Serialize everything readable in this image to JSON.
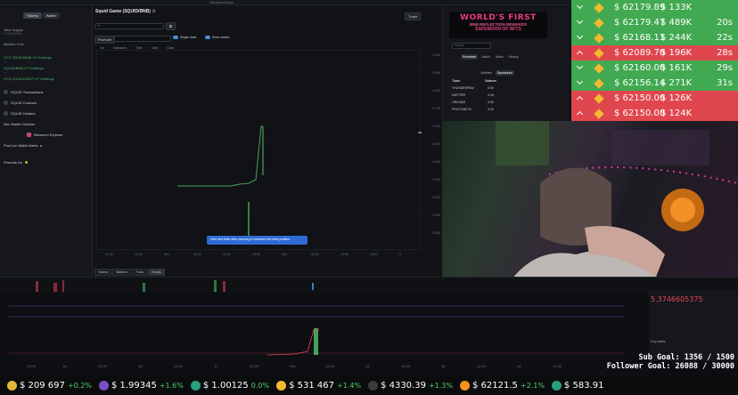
{
  "top_strip": {
    "title": "Advanced Now"
  },
  "sidebar": {
    "toggle": [
      "Tokens",
      "Wallet"
    ],
    "total_supply_label": "Total Supply",
    "total_supply_value": "0.000000000",
    "marked_coin_label": "Marked Coin",
    "lines": [
      "PCS SQUID/BNB LP Holdings",
      "SQUID/BNB LP Holdings",
      "PCS SQUID/USDT LP Holdings"
    ],
    "items": [
      "SQUID Transactions",
      "SQUID Contract",
      "SQUID Holders",
      "Dev Wallet Checker",
      "Bitsearch Explorer",
      "PooCoin Wallet Alerts"
    ],
    "promote_label": "Promote Ad"
  },
  "main": {
    "title": "Squid Game (SQUID/BNB)",
    "promote": "Promote",
    "trade": "Trade",
    "address_placeholder": "0x...",
    "toolbar": [
      "1m",
      "Indicators",
      "Time",
      "Limit",
      "Clear"
    ],
    "single_chart": "Single chart",
    "show_trades": "Show trades",
    "y_ticks": [
      "1.000",
      "0.900",
      "0.800",
      "0.700",
      "0.600",
      "0.500",
      "0.400",
      "0.300",
      "0.200",
      "0.100",
      "0.000"
    ],
    "x_ticks": [
      "12:00",
      "18:00",
      "Nov",
      "06:00",
      "12:00",
      "18:00",
      "Nov",
      "06:00",
      "12:00",
      "18:00",
      "2"
    ],
    "tooltip": "Hold and flash  after pausing to maintain the chart position",
    "bottom_tabs": [
      "Tokens",
      "Wallet tx",
      "Pools",
      "Swaps"
    ]
  },
  "right_panel": {
    "banner_l1": "WORLD'S FIRST",
    "banner_l2": "BNB REFLECTION REWARDS",
    "banner_l3": "SAFEMOON OF NFTS",
    "search_placeholder": "Search",
    "tabs": [
      "Promoted",
      "Watch",
      "Alerts",
      "History"
    ],
    "subtabs": [
      "Unlisted",
      "Sponsored"
    ],
    "columns": [
      "Token",
      "Balance"
    ],
    "rows": [
      {
        "token": "THUNDERPAW",
        "balance": "0.00"
      },
      {
        "token": "DWTTER",
        "balance": "0.00"
      },
      {
        "token": "ORIGAMI",
        "balance": "0.00"
      },
      {
        "token": "PROTOMETA",
        "balance": "0.00"
      }
    ]
  },
  "ticker": {
    "rows": [
      {
        "price": "$ 62179.89",
        "vol": "$ 133K",
        "time": "",
        "color": "green"
      },
      {
        "price": "$ 62179.47",
        "vol": "$ 489K",
        "time": "20s",
        "color": "green"
      },
      {
        "price": "$ 62168.11",
        "vol": "$ 244K",
        "time": "22s",
        "color": "green"
      },
      {
        "price": "$ 62089.70",
        "vol": "$ 196K",
        "time": "28s",
        "color": "red"
      },
      {
        "price": "$ 62160.00",
        "vol": "$ 161K",
        "time": "29s",
        "color": "green"
      },
      {
        "price": "$ 62156.14",
        "vol": "$ 271K",
        "time": "31s",
        "color": "green"
      },
      {
        "price": "$ 62150.00",
        "vol": "$ 126K",
        "time": "",
        "color": "red"
      },
      {
        "price": "$ 62150.00",
        "vol": "$ 124K",
        "time": "",
        "color": "red"
      }
    ]
  },
  "lower_right": {
    "price": "5.3746605375",
    "label": "Key stats"
  },
  "goals": {
    "sub": "Sub Goal: 1356 / 1500",
    "follower": "Follower Goal: 26088 / 30000"
  },
  "bottom_ticker": [
    {
      "price": "$ 209 697",
      "chg": "+0.2%",
      "color": "#e1b53a"
    },
    {
      "price": "$ 1.99345",
      "chg": "+1.6%",
      "color": "#7a4fc8"
    },
    {
      "price": "$ 1.00125",
      "chg": "0.0%",
      "color": "#26a17b"
    },
    {
      "price": "$ 531 467",
      "chg": "+1.4%",
      "color": "#f3ba2f"
    },
    {
      "price": "$ 4330.39",
      "chg": "+1.3%",
      "color": "#3c3c3d"
    },
    {
      "price": "$ 62121.5",
      "chg": "+2.1%",
      "color": "#f7931a"
    },
    {
      "price": "$ 583.91",
      "chg": "",
      "color": "#26a17b"
    }
  ]
}
